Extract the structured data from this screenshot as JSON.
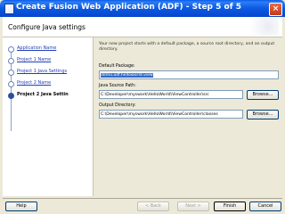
{
  "window": {
    "title": "Create Fusion Web Application (ADF) - Step 5 of 5",
    "close_glyph": "×"
  },
  "header": {
    "title": "Configure Java settings"
  },
  "nav": {
    "items": [
      {
        "label": "Application Name",
        "current": false
      },
      {
        "label": "Project 1 Name",
        "current": false
      },
      {
        "label": "Project 1 Java Settings",
        "current": false
      },
      {
        "label": "Project 2 Name",
        "current": false
      },
      {
        "label": "Project 2 Java Settin",
        "current": true
      }
    ]
  },
  "content": {
    "description": "Your new project starts with a default package, a source root directory, and an output directory.",
    "default_package_label": "Default Package:",
    "default_package_value": "demo.adf.helloworld.view",
    "java_source_path_label": "Java Source Path:",
    "java_source_path_value": "C:\\Developer\\myswork\\HelloWorld\\ViewController\\src",
    "output_directory_label": "Output Directory:",
    "output_directory_value": "C:\\Developer\\myswork\\HelloWorld\\ViewController\\classes",
    "browse_label": "Browse..."
  },
  "footer": {
    "help_label": "Help",
    "back_label": "< Back",
    "next_label": "Next >",
    "finish_label": "Finish",
    "cancel_label": "Cancel"
  },
  "colors": {
    "title_bar": "#0b59e2",
    "selection": "#316ac5",
    "link": "#1f3fb6",
    "dialog_bg": "#ece9d8"
  }
}
